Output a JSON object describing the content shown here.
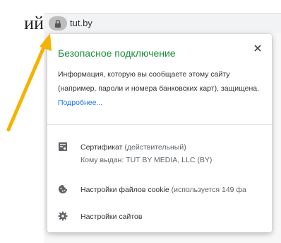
{
  "background_text": "ий",
  "address_bar": {
    "url": "tut.by",
    "lock_icon": "lock-icon"
  },
  "popup": {
    "title": "Безопасное подключение",
    "info_text": "Информация, которую вы сообщаете этому сайту (например, пароли и номера банковских карт), защищена.",
    "more_link": "Подробнее...",
    "certificate": {
      "icon": "certificate-icon",
      "label": "Сертификат",
      "status": "(действительный)",
      "issued_to": "Кому выдан: TUT BY MEDIA, LLC (BY)"
    },
    "cookies": {
      "icon": "cookie-icon",
      "label": "Настройки файлов cookie",
      "detail": "(используется 149 фа"
    },
    "site_settings": {
      "icon": "gear-icon",
      "label": "Настройки сайтов"
    }
  },
  "colors": {
    "title_green": "#1e8e3e",
    "link_blue": "#1a73e8",
    "arrow_orange": "#f5b301"
  }
}
